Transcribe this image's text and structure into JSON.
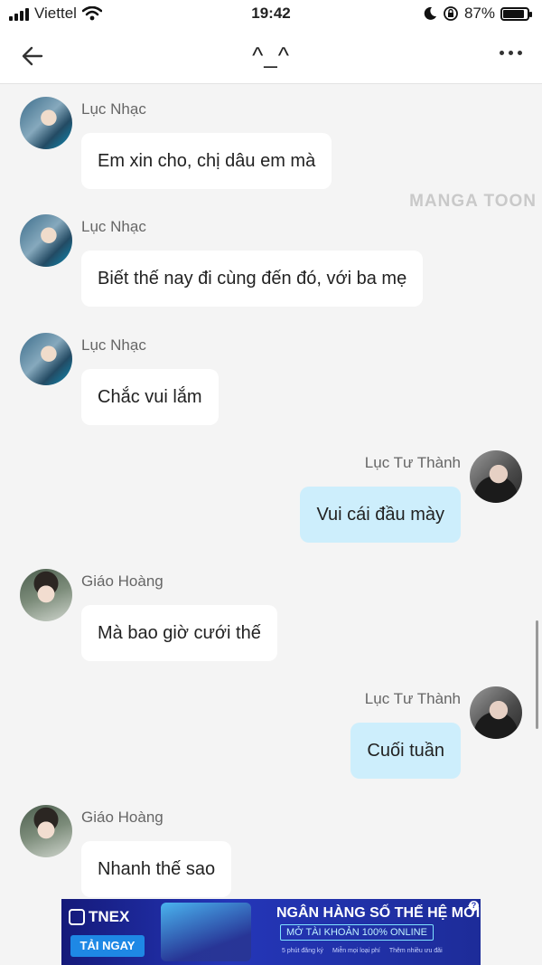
{
  "status_bar": {
    "carrier": "Viettel",
    "time": "19:42",
    "battery": "87%",
    "battery_level": 0.87
  },
  "header": {
    "title": "^_^"
  },
  "watermark": "MANGA TOON",
  "messages": [
    {
      "sender": "Lục Nhạc",
      "text": "Em xin cho, chị dâu em mà",
      "side": "left"
    },
    {
      "sender": "Lục Nhạc",
      "text": "Biết thế nay đi cùng đến đó, với ba mẹ",
      "side": "left"
    },
    {
      "sender": "Lục Nhạc",
      "text": "Chắc vui lắm",
      "side": "left"
    },
    {
      "sender": "Lục Tư Thành",
      "text": "Vui cái đầu mày",
      "side": "right"
    },
    {
      "sender": "Giáo Hoàng",
      "text": "Mà bao giờ cưới thế",
      "side": "left"
    },
    {
      "sender": "Lục Tư Thành",
      "text": "Cuối tuần",
      "side": "right"
    },
    {
      "sender": "Giáo Hoàng",
      "text": "Nhanh thế sao",
      "side": "left"
    }
  ],
  "ad": {
    "brand": "TNEX",
    "cta": "TẢI NGAY",
    "headline": "NGÂN HÀNG SỐ THẾ HỆ MỚI",
    "subline": "MỞ TÀI KHOẢN 100% ONLINE",
    "features": [
      "5 phút đăng ký",
      "Miễn mọi loại phí",
      "Thêm nhiều ưu đãi"
    ],
    "help": "?"
  }
}
